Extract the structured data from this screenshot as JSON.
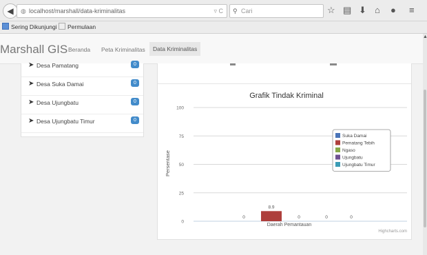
{
  "browser": {
    "url": "localhost/marshall/data-kriminalitas",
    "search_placeholder": "Cari",
    "back_glyph": "◀",
    "reload_glyph": "▿ C"
  },
  "bookmarks": {
    "items": [
      {
        "label": "Sering Dikunjungi",
        "icon": "globe-icon"
      },
      {
        "label": "Permulaan",
        "icon": "page-icon"
      }
    ]
  },
  "navbar": {
    "brand": "Marshall GIS",
    "links": [
      {
        "label": "Beranda"
      },
      {
        "label": "Peta Kriminalitas"
      },
      {
        "label": "Data Kriminalitas",
        "active": true
      }
    ]
  },
  "sidebar": {
    "items": [
      {
        "label": "Desa Pamatang",
        "badge": "0"
      },
      {
        "label": "Desa Suka Damai",
        "badge": "0"
      },
      {
        "label": "Desa Ujungbatu",
        "badge": "0"
      },
      {
        "label": "Desa Ujungbatu Timur",
        "badge": "0"
      }
    ]
  },
  "chart_data": {
    "type": "bar",
    "title": "Grafik Tindak Kriminal",
    "xlabel": "",
    "ylabel": "Persentase",
    "categories": [
      "Daerah Pemantauan"
    ],
    "ylim": [
      0,
      100
    ],
    "yticks": [
      0,
      25,
      50,
      75,
      100
    ],
    "grid": true,
    "legend_position": "right",
    "credits": "Highcharts.com",
    "series": [
      {
        "name": "Suka Damai",
        "color": "#4a74b8",
        "values": [
          0
        ],
        "label": "0"
      },
      {
        "name": "Pematang Tebih",
        "color": "#ae3f3c",
        "values": [
          8.9
        ],
        "label": "8.9"
      },
      {
        "name": "Ngaso",
        "color": "#86a849",
        "values": [
          0
        ],
        "label": "0"
      },
      {
        "name": "Ujungbatu",
        "color": "#6f5092",
        "values": [
          0
        ],
        "label": "0"
      },
      {
        "name": "Ujungbatu Timur",
        "color": "#3c9cb5",
        "values": [
          0
        ],
        "label": "0"
      }
    ]
  }
}
